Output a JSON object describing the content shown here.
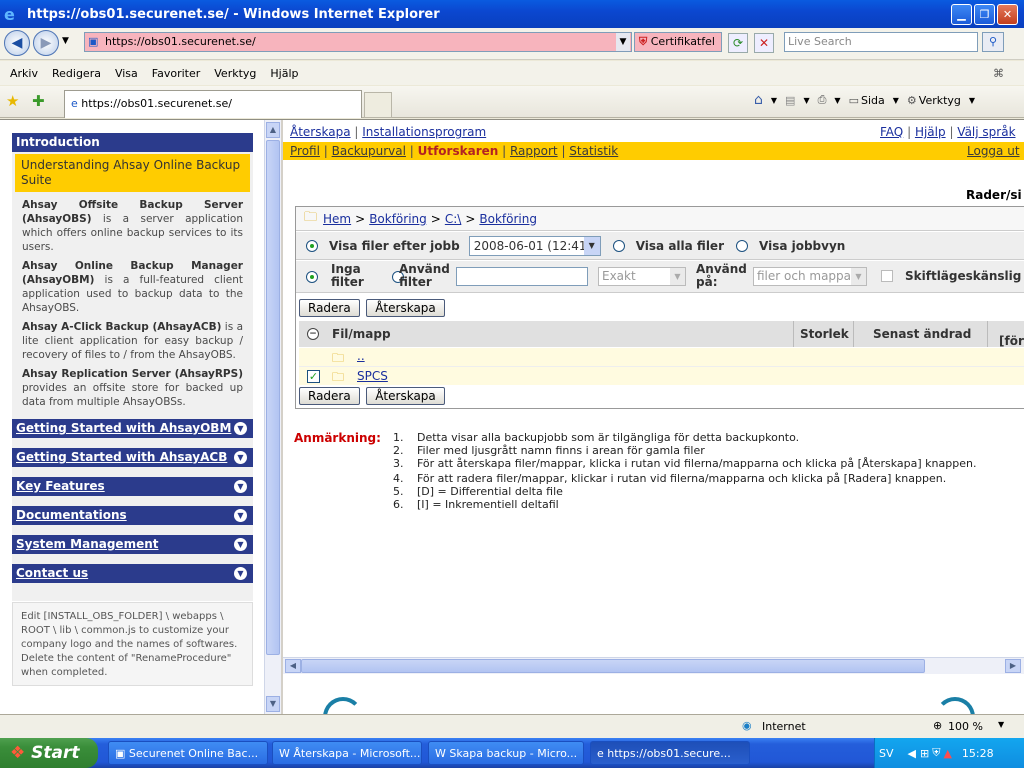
{
  "window": {
    "title": "https://obs01.securenet.se/ - Windows Internet Explorer"
  },
  "address": {
    "url": "https://obs01.securenet.se/",
    "cert_error": "Certifikatfel",
    "search_placeholder": "Live Search"
  },
  "menu": [
    "Arkiv",
    "Redigera",
    "Visa",
    "Favoriter",
    "Verktyg",
    "Hjälp"
  ],
  "tab": {
    "label": "https://obs01.securenet.se/"
  },
  "toolbar": {
    "page": "Sida",
    "tools": "Verktyg"
  },
  "sidebar": {
    "intro_header": "Introduction",
    "intro_title": "Understanding Ahsay Online Backup Suite",
    "products": [
      {
        "name": "Ahsay Offsite Backup Server (AhsayOBS)",
        "desc": " is a server application which offers online backup services to its users."
      },
      {
        "name": "Ahsay Online Backup Manager (AhsayOBM)",
        "desc": " is a full-featured client application used to backup data to the AhsayOBS."
      },
      {
        "name": "Ahsay A-Click Backup (AhsayACB)",
        "desc": " is a lite client application for easy backup / recovery of files to / from the AhsayOBS."
      },
      {
        "name": "Ahsay Replication Server (AhsayRPS)",
        "desc": " provides an offsite store for backed up data from multiple AhsayOBSs."
      }
    ],
    "nav": [
      "Getting Started with AhsayOBM",
      "Getting Started with AhsayACB",
      "Key Features",
      "Documentations",
      "System Management",
      "Contact us"
    ],
    "footer_note": "Edit [INSTALL_OBS_FOLDER] \\ webapps \\ ROOT \\ lib \\ common.js to customize your company logo and the names of softwares. Delete the content of \"RenameProcedure\" when completed."
  },
  "topnav": {
    "left": [
      "Återskapa",
      "Installationsprogram"
    ],
    "right": [
      "FAQ",
      "Hjälp",
      "Välj språk"
    ],
    "tabs": [
      "Profil",
      "Backupurval",
      "Utforskaren",
      "Rapport",
      "Statistik"
    ],
    "active_tab": "Utforskaren",
    "logout": "Logga ut"
  },
  "explorer": {
    "cut_header": "Rader/si",
    "breadcrumb": [
      "Hem",
      "Bokföring",
      "C:\\",
      "Bokföring"
    ],
    "view_by_job": "Visa filer efter jobb",
    "job_date": "2008-06-01 (12:41)",
    "view_all": "Visa alla filer",
    "view_job": "Visa jobbvyn",
    "no_filter": "Inga filter",
    "use_filter": "Använd filter",
    "filter_mode": "Exakt",
    "apply_on": "Använd på:",
    "apply_target": "filer och mappar",
    "case_sensitive": "Skiftlägeskänslig",
    "btn_delete": "Radera",
    "btn_restore": "Återskapa",
    "col_file": "Fil/mapp",
    "col_size": "Storlek",
    "col_modified": "Senast ändrad",
    "col_cut": "[för",
    "rows": [
      {
        "name": "..",
        "checked": false
      },
      {
        "name": "SPCS",
        "checked": true
      }
    ]
  },
  "notes": {
    "label": "Anmärkning:",
    "items": [
      "Detta visar alla backupjobb som är tilgängliga för detta backupkonto.",
      "Filer med ljusgrått namn finns i arean för gamla filer",
      "För att återskapa filer/mappar, klicka i rutan vid filerna/mapparna och klicka på [Återskapa] knappen.",
      "För att radera filer/mappar, klickar i rutan vid filerna/mapparna och klicka på [Radera] knappen.",
      "[D] = Differential delta file",
      "[I] = Inkrementiell deltafil"
    ]
  },
  "status": {
    "zone": "Internet",
    "zoom": "100 %"
  },
  "taskbar": {
    "start": "Start",
    "tasks": [
      "Securenet Online Bac...",
      "Återskapa - Microsoft...",
      "Skapa backup - Micro...",
      "https://obs01.secure..."
    ],
    "lang": "SV",
    "time": "15:28"
  }
}
